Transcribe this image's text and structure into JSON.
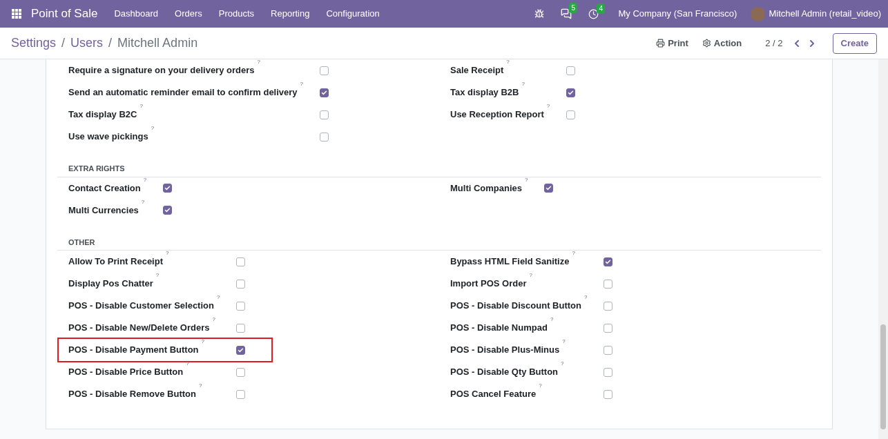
{
  "navbar": {
    "app_name": "Point of Sale",
    "menu": [
      "Dashboard",
      "Orders",
      "Products",
      "Reporting",
      "Configuration"
    ],
    "messages_count": "5",
    "activities_count": "4",
    "company": "My Company (San Francisco)",
    "user": "Mitchell Admin (retail_video)"
  },
  "control_panel": {
    "breadcrumbs": [
      "Settings",
      "Users",
      "Mitchell Admin"
    ],
    "breadcrumb_separator": "/",
    "print_label": "Print",
    "action_label": "Action",
    "pager": "2 / 2",
    "create_label": "Create"
  },
  "sections": [
    {
      "left": [
        {
          "label": "Require a signature on your delivery orders",
          "help": "?",
          "checked": false,
          "highlighted": false
        },
        {
          "label": "Send an automatic reminder email to confirm delivery",
          "help": "?",
          "checked": true,
          "highlighted": false
        },
        {
          "label": "Tax display B2C",
          "help": "?",
          "checked": false,
          "highlighted": false
        },
        {
          "label": "Use wave pickings",
          "help": "?",
          "checked": false,
          "highlighted": false
        }
      ],
      "right": [
        {
          "label": "Sale Receipt",
          "help": "?",
          "checked": false,
          "highlighted": false
        },
        {
          "label": "Tax display B2B",
          "help": "?",
          "checked": true,
          "highlighted": false
        },
        {
          "label": "Use Reception Report",
          "help": "?",
          "checked": false,
          "highlighted": false
        }
      ]
    },
    {
      "title": "EXTRA RIGHTS",
      "left": [
        {
          "label": "Contact Creation",
          "help": "?",
          "checked": true,
          "highlighted": false
        },
        {
          "label": "Multi Currencies",
          "help": "?",
          "checked": true,
          "highlighted": false
        }
      ],
      "right": [
        {
          "label": "Multi Companies",
          "help": "?",
          "checked": true,
          "highlighted": false
        }
      ]
    },
    {
      "title": "OTHER",
      "left": [
        {
          "label": "Allow To Print Receipt",
          "help": "?",
          "checked": false,
          "highlighted": false
        },
        {
          "label": "Display Pos Chatter",
          "help": "?",
          "checked": false,
          "highlighted": false
        },
        {
          "label": "POS - Disable Customer Selection",
          "help": "?",
          "checked": false,
          "highlighted": false
        },
        {
          "label": "POS - Disable New/Delete Orders",
          "help": "?",
          "checked": false,
          "highlighted": false
        },
        {
          "label": "POS - Disable Payment Button",
          "help": "?",
          "checked": true,
          "highlighted": true
        },
        {
          "label": "POS - Disable Price Button",
          "help": "?",
          "checked": false,
          "highlighted": false
        },
        {
          "label": "POS - Disable Remove Button",
          "help": "?",
          "checked": false,
          "highlighted": false
        }
      ],
      "right": [
        {
          "label": "Bypass HTML Field Sanitize",
          "help": "?",
          "checked": true,
          "highlighted": false
        },
        {
          "label": "Import POS Order",
          "help": "?",
          "checked": false,
          "highlighted": false
        },
        {
          "label": "POS - Disable Discount Button",
          "help": "?",
          "checked": false,
          "highlighted": false
        },
        {
          "label": "POS - Disable Numpad",
          "help": "?",
          "checked": false,
          "highlighted": false
        },
        {
          "label": "POS - Disable Plus-Minus",
          "help": "?",
          "checked": false,
          "highlighted": false
        },
        {
          "label": "POS - Disable Qty Button",
          "help": "?",
          "checked": false,
          "highlighted": false
        },
        {
          "label": "POS Cancel Feature",
          "help": "?",
          "checked": false,
          "highlighted": false
        }
      ]
    }
  ]
}
